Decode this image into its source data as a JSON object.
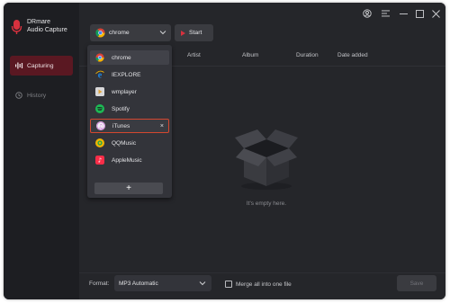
{
  "app": {
    "title_line1": "DRmare",
    "title_line2": "Audio Capture"
  },
  "sidebar": {
    "items": [
      {
        "label": "Capturing",
        "icon": "waveform-icon",
        "active": true
      },
      {
        "label": "History",
        "icon": "clock-icon",
        "active": false
      }
    ]
  },
  "window_controls": [
    "account-icon",
    "menu-icon",
    "minimize-icon",
    "maximize-icon",
    "close-icon"
  ],
  "toolbar": {
    "source_value": "chrome",
    "start_label": "Start"
  },
  "columns": [
    "Artist",
    "Album",
    "Duration",
    "Date added"
  ],
  "dropdown": {
    "items": [
      {
        "label": "chrome",
        "icon": "chrome-icon",
        "color": "#4285f4"
      },
      {
        "label": "IEXPLORE",
        "icon": "ie-icon",
        "color": "#1e88e5"
      },
      {
        "label": "wmplayer",
        "icon": "wmplayer-icon",
        "color": "#e0a53a"
      },
      {
        "label": "Spotify",
        "icon": "spotify-icon",
        "color": "#1db954"
      },
      {
        "label": "iTunes",
        "icon": "itunes-icon",
        "color": "#c86dd7"
      },
      {
        "label": "QQMusic",
        "icon": "qqmusic-icon",
        "color": "#f0b400"
      },
      {
        "label": "AppleMusic",
        "icon": "applemusic-icon",
        "color": "#fa2d48"
      }
    ],
    "add_label": "+"
  },
  "empty_state": {
    "text": "It's empty here."
  },
  "bottom_bar": {
    "format_label": "Format:",
    "format_value": "MP3 Automatic",
    "merge_label": "Merge all into one file",
    "save_label": "Save"
  },
  "colors": {
    "accent": "#d7313e",
    "active_nav": "#5a1822",
    "highlight_border": "#d5472f"
  }
}
